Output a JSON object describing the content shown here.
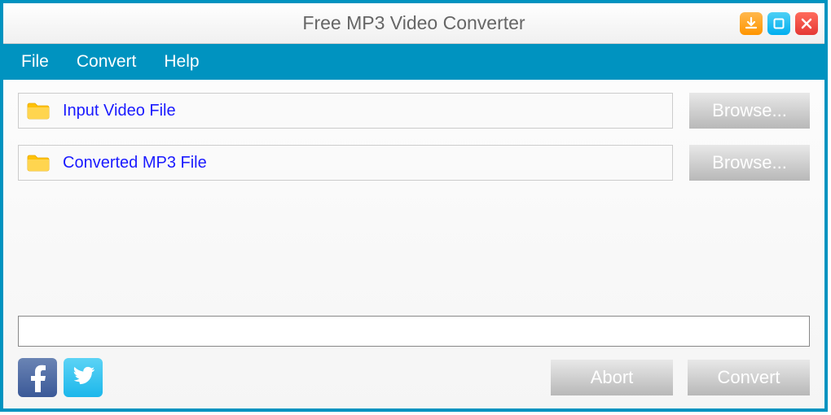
{
  "title": "Free MP3 Video Converter",
  "menu": {
    "file": "File",
    "convert": "Convert",
    "help": "Help"
  },
  "input": {
    "placeholder": "Input Video File",
    "browse": "Browse..."
  },
  "output": {
    "placeholder": "Converted MP3 File",
    "browse": "Browse..."
  },
  "actions": {
    "abort": "Abort",
    "convert": "Convert"
  },
  "colors": {
    "accent": "#0093c0",
    "placeholder": "#1a1aff",
    "download_btn": "#ff9500",
    "maximize_btn": "#00aeef",
    "close_btn": "#e53935",
    "facebook": "#3b5998",
    "twitter": "#1cb7eb"
  }
}
